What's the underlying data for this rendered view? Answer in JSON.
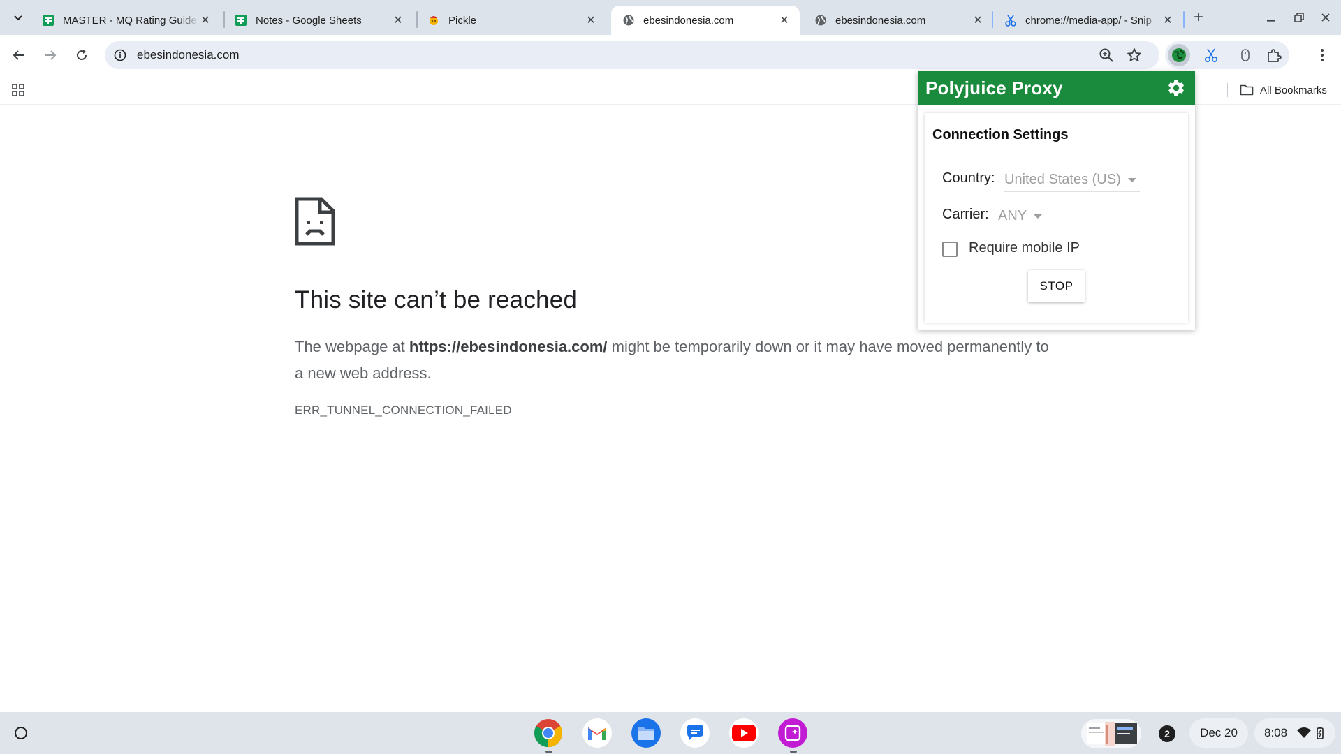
{
  "tabs": [
    {
      "title": "MASTER - MQ Rating Guide",
      "favicon": "google-sheets-icon",
      "active": false
    },
    {
      "title": "Notes - Google Sheets",
      "favicon": "google-sheets-icon",
      "active": false
    },
    {
      "title": "Pickle",
      "favicon": "pickle-icon",
      "active": false
    },
    {
      "title": "ebesindonesia.com",
      "favicon": "globe-icon",
      "active": true
    },
    {
      "title": "ebesindonesia.com",
      "favicon": "globe-icon",
      "active": false
    },
    {
      "title": "chrome://media-app/ - Snip",
      "favicon": "scissors-icon",
      "active": false
    }
  ],
  "toolbar": {
    "url": "ebesindonesia.com"
  },
  "bookmarks": {
    "all_bookmarks_label": "All Bookmarks"
  },
  "error_page": {
    "title": "This site can’t be reached",
    "desc_prefix": "The webpage at ",
    "desc_url": "https://ebesindonesia.com/",
    "desc_suffix": " might be temporarily down or it may have moved permanently to a new web address.",
    "error_code": "ERR_TUNNEL_CONNECTION_FAILED"
  },
  "popup": {
    "title": "Polyjuice Proxy",
    "section_title": "Connection Settings",
    "country_label": "Country:",
    "country_value": "United States (US)",
    "carrier_label": "Carrier:",
    "carrier_value": "ANY",
    "require_mobile_label": "Require mobile IP",
    "require_mobile_checked": false,
    "stop_label": "STOP",
    "header_color": "#1a8a3c"
  },
  "shelf": {
    "apps": [
      "chrome-icon",
      "gmail-icon",
      "files-icon",
      "messages-icon",
      "youtube-icon",
      "screencast-icon"
    ],
    "notification_count": "2",
    "date": "Dec 20",
    "time": "8:08"
  }
}
